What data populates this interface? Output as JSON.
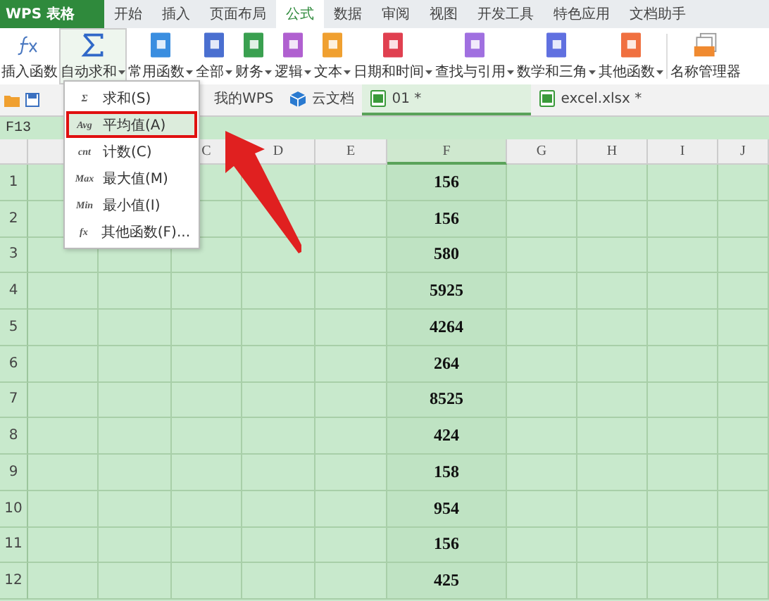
{
  "app_button": "WPS 表格",
  "menu_tabs": [
    {
      "label": "开始",
      "selected": false
    },
    {
      "label": "插入",
      "selected": false
    },
    {
      "label": "页面布局",
      "selected": false
    },
    {
      "label": "公式",
      "selected": true
    },
    {
      "label": "数据",
      "selected": false
    },
    {
      "label": "审阅",
      "selected": false
    },
    {
      "label": "视图",
      "selected": false
    },
    {
      "label": "开发工具",
      "selected": false
    },
    {
      "label": "特色应用",
      "selected": false
    },
    {
      "label": "文档助手",
      "selected": false
    }
  ],
  "ribbon": [
    {
      "kind": "fx",
      "label": "插入函数",
      "dropdown": false,
      "open": false
    },
    {
      "kind": "sigma",
      "label": "自动求和",
      "dropdown": true,
      "open": true
    },
    {
      "kind": "book",
      "label": "常用函数",
      "dropdown": true,
      "open": false,
      "color": "#3a8ee0"
    },
    {
      "kind": "book",
      "label": "全部",
      "dropdown": true,
      "open": false,
      "color": "#4a6fd0"
    },
    {
      "kind": "book",
      "label": "财务",
      "dropdown": true,
      "open": false,
      "color": "#3aa050"
    },
    {
      "kind": "book",
      "label": "逻辑",
      "dropdown": true,
      "open": false,
      "color": "#b060d0"
    },
    {
      "kind": "book",
      "label": "文本",
      "dropdown": true,
      "open": false,
      "color": "#f0a030"
    },
    {
      "kind": "book",
      "label": "日期和时间",
      "dropdown": true,
      "open": false,
      "color": "#e04050"
    },
    {
      "kind": "book",
      "label": "查找与引用",
      "dropdown": true,
      "open": false,
      "color": "#a070e0"
    },
    {
      "kind": "book",
      "label": "数学和三角",
      "dropdown": true,
      "open": false,
      "color": "#6070e0"
    },
    {
      "kind": "book",
      "label": "其他函数",
      "dropdown": true,
      "open": false,
      "color": "#f07040"
    },
    {
      "kind": "names",
      "label": "名称管理器",
      "dropdown": false,
      "open": false
    }
  ],
  "doc_tabs": [
    {
      "kind": "plain",
      "label": "我的WPS",
      "selected": false
    },
    {
      "kind": "cloud",
      "label": "云文档",
      "selected": false
    },
    {
      "kind": "sheet",
      "label": "01 *",
      "selected": true
    },
    {
      "kind": "sheet",
      "label": "excel.xlsx *",
      "selected": false
    }
  ],
  "name_box": "F13",
  "columns": [
    {
      "label": "C",
      "selected": false
    },
    {
      "label": "D",
      "selected": false
    },
    {
      "label": "E",
      "selected": false
    },
    {
      "label": "F",
      "selected": true
    },
    {
      "label": "G",
      "selected": false
    },
    {
      "label": "H",
      "selected": false
    },
    {
      "label": "I",
      "selected": false
    },
    {
      "label": "J",
      "selected": false
    }
  ],
  "rows": [
    {
      "number": "1",
      "value": "156"
    },
    {
      "number": "2",
      "value": "156"
    },
    {
      "number": "3",
      "value": "580"
    },
    {
      "number": "4",
      "value": "5925"
    },
    {
      "number": "5",
      "value": "4264"
    },
    {
      "number": "6",
      "value": "264"
    },
    {
      "number": "7",
      "value": "8525"
    },
    {
      "number": "8",
      "value": "424"
    },
    {
      "number": "9",
      "value": "158"
    },
    {
      "number": "10",
      "value": "954"
    },
    {
      "number": "11",
      "value": "156"
    },
    {
      "number": "12",
      "value": "425"
    }
  ],
  "dropdown_menu": [
    {
      "icon_text": "Σ",
      "label": "求和(S)",
      "highlighted": false
    },
    {
      "icon_text": "Avg",
      "label": "平均值(A)",
      "highlighted": true
    },
    {
      "icon_text": "cnt",
      "label": "计数(C)",
      "highlighted": false
    },
    {
      "icon_text": "Max",
      "label": "最大值(M)",
      "highlighted": false
    },
    {
      "icon_text": "Min",
      "label": "最小值(I)",
      "highlighted": false
    },
    {
      "icon_text": "fx",
      "label": "其他函数(F)...",
      "highlighted": false
    }
  ]
}
